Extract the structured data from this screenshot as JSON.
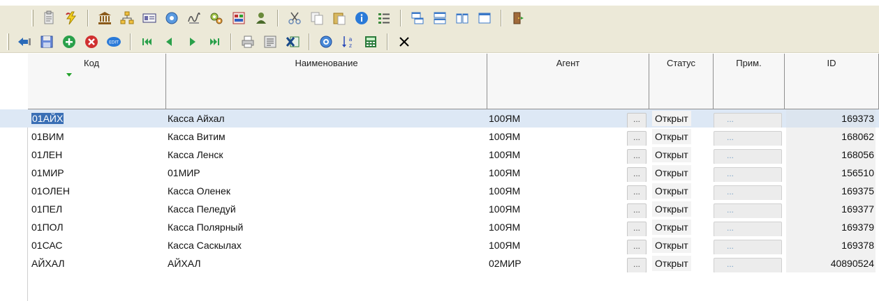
{
  "toolbar_top": {
    "icons": [
      {
        "name": "clipboard-icon",
        "color": "#8a8a8a"
      },
      {
        "name": "lightning-icon",
        "color": "#c8a400"
      },
      {
        "name": "bank-icon",
        "color": "#8b5a1a"
      },
      {
        "name": "structure-icon",
        "color": "#d4a020"
      },
      {
        "name": "card-icon",
        "color": "#3a3a7a"
      },
      {
        "name": "globe-icon",
        "color": "#3a78c8"
      },
      {
        "name": "signature-icon",
        "color": "#555555"
      },
      {
        "name": "gears-icon",
        "color": "#7a9a3a"
      },
      {
        "name": "report-icon",
        "color": "#b03030"
      },
      {
        "name": "people-icon",
        "color": "#4a6a2a"
      },
      {
        "name": "scissors-icon",
        "color": "#6a8ab8"
      },
      {
        "name": "copy-icon",
        "color": "#a0a0a0"
      },
      {
        "name": "paste-icon",
        "color": "#a07a20"
      },
      {
        "name": "info-icon",
        "color": "#2a7ad8"
      },
      {
        "name": "list-icon",
        "color": "#3a8a3a"
      },
      {
        "name": "tile-horizontal-icon",
        "color": "#3a78c8"
      },
      {
        "name": "tile-rows-icon",
        "color": "#3a78c8"
      },
      {
        "name": "tile-columns-icon",
        "color": "#3a78c8"
      },
      {
        "name": "window-icon",
        "color": "#3a78c8"
      },
      {
        "name": "exit-door-icon",
        "color": "#7a4a2a"
      }
    ]
  },
  "toolbar_nav": {
    "icons": [
      {
        "name": "back-icon",
        "color": "#2a6ab8"
      },
      {
        "name": "save-icon",
        "color": "#4a6ab8"
      },
      {
        "name": "add-icon",
        "color": "#2aa04a"
      },
      {
        "name": "delete-icon",
        "color": "#d03030"
      },
      {
        "name": "edit-icon",
        "color": "#2a7ad8"
      },
      {
        "name": "first-record-icon",
        "color": "#2aa04a"
      },
      {
        "name": "prev-record-icon",
        "color": "#2aa04a"
      },
      {
        "name": "next-record-icon",
        "color": "#2aa04a"
      },
      {
        "name": "last-record-icon",
        "color": "#2aa04a"
      },
      {
        "name": "print-icon",
        "color": "#7a7a7a"
      },
      {
        "name": "form-icon",
        "color": "#7a7a7a"
      },
      {
        "name": "excel-icon",
        "color": "#2a7a3a"
      },
      {
        "name": "refresh-icon",
        "color": "#2a7ad8"
      },
      {
        "name": "sort-az-icon",
        "color": "#2a4ab8"
      },
      {
        "name": "calculator-icon",
        "color": "#2a7a3a"
      },
      {
        "name": "close-icon",
        "color": "#000000"
      }
    ]
  },
  "grid": {
    "columns": {
      "code": "Код",
      "name": "Наименование",
      "agent": "Агент",
      "status": "Статус",
      "note": "Прим.",
      "id": "ID"
    },
    "ellipsis": "...",
    "rows": [
      {
        "code": "01АЙХ",
        "name": "Касса Айхал",
        "agent": "100ЯМ",
        "status": "Открыт",
        "id": "169373"
      },
      {
        "code": "01ВИМ",
        "name": "Касса Витим",
        "agent": "100ЯМ",
        "status": "Открыт",
        "id": "168062"
      },
      {
        "code": "01ЛЕН",
        "name": "Касса Ленск",
        "agent": "100ЯМ",
        "status": "Открыт",
        "id": "168056"
      },
      {
        "code": "01МИР",
        "name": "01МИР",
        "agent": "100ЯМ",
        "status": "Открыт",
        "id": "156510"
      },
      {
        "code": "01ОЛЕН",
        "name": "Касса Оленек",
        "agent": "100ЯМ",
        "status": "Открыт",
        "id": "169375"
      },
      {
        "code": "01ПЕЛ",
        "name": "Касса Пеледуй",
        "agent": "100ЯМ",
        "status": "Открыт",
        "id": "169377"
      },
      {
        "code": "01ПОЛ",
        "name": "Касса Полярный",
        "agent": "100ЯМ",
        "status": "Открыт",
        "id": "169379"
      },
      {
        "code": "01САС",
        "name": "Касса Саскылах",
        "agent": "100ЯМ",
        "status": "Открыт",
        "id": "169378"
      },
      {
        "code": "АЙХАЛ",
        "name": "АЙХАЛ",
        "agent": "02МИР",
        "status": "Открыт",
        "id": "40890524"
      }
    ]
  }
}
